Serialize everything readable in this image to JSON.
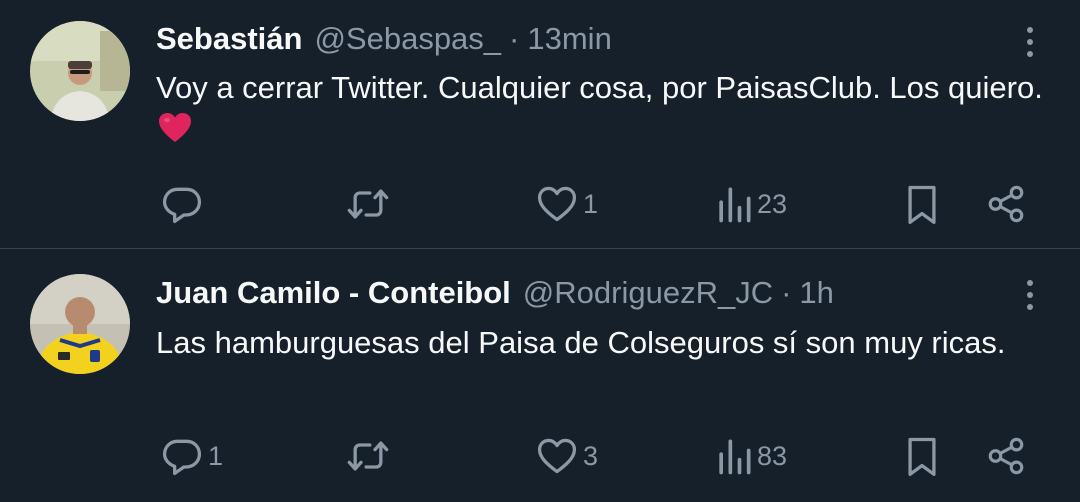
{
  "tweets": [
    {
      "display_name": "Sebastián",
      "handle": "@Sebaspas_",
      "separator": "·",
      "time": "13min",
      "text": "Voy a cerrar Twitter. Cualquier cosa, por PaisasClub. Los quiero.",
      "emoji": "red-heart",
      "replies": "",
      "retweets": "",
      "likes": "1",
      "views": "23"
    },
    {
      "display_name": "Juan Camilo - Conteibol",
      "handle": "@RodriguezR_JC",
      "separator": "·",
      "time": "1h",
      "text": "Las hamburguesas del Paisa de Colseguros sí son muy ricas.",
      "replies": "1",
      "retweets": "",
      "likes": "3",
      "views": "83"
    }
  ],
  "icons": {
    "reply": "reply-icon",
    "retweet": "retweet-icon",
    "like": "heart-icon",
    "views": "views-icon",
    "bookmark": "bookmark-icon",
    "share": "share-icon",
    "more": "more-vertical-icon"
  },
  "colors": {
    "background": "#15202b",
    "primary_text": "#f7f9f9",
    "secondary_text": "#8b98a5",
    "divider": "#38444d",
    "heart_emoji": "#e0245e"
  }
}
